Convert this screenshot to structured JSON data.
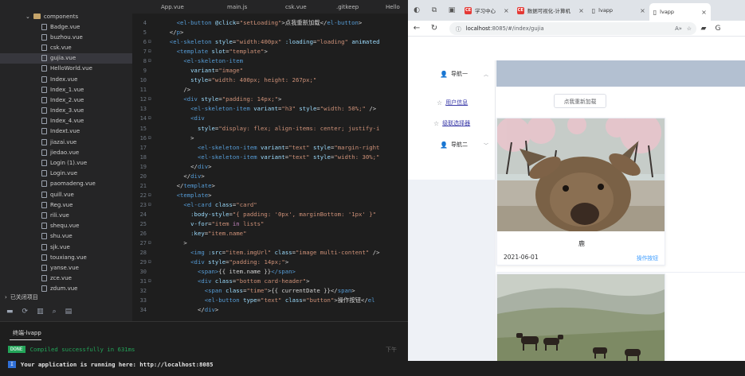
{
  "explorer": {
    "folder": "components",
    "files": [
      "Badge.vue",
      "buzhou.vue",
      "csk.vue",
      "gujia.vue",
      "HelloWorld.vue",
      "Index.vue",
      "Index_1.vue",
      "Index_2.vue",
      "Index_3.vue",
      "Index_4.vue",
      "Indext.vue",
      "jiazai.vue",
      "jiedao.vue",
      "Login (1).vue",
      "Login.vue",
      "paomadeng.vue",
      "quill.vue",
      "Reg.vue",
      "rili.vue",
      "shequ.vue",
      "shu.vue",
      "sjk.vue",
      "touxiang.vue",
      "yanse.vue",
      "zce.vue",
      "zdum.vue"
    ],
    "active_file": "gujia.vue",
    "closed_projects": "已关闭项目"
  },
  "editor": {
    "tabs": [
      "App.vue",
      "main.js",
      "csk.vue",
      ".gitkeep",
      "Hello"
    ],
    "lines": [
      {
        "n": "4",
        "fold": false,
        "html": "<span class='g'>    </span><span class='tg'>&lt;el-button</span> <span class='at'>@click</span>=<span class='st'>\"setLoading\"</span><span class='tx'>&gt;点我重新加载&lt;/</span><span class='tg'>el-button</span><span class='tx'>&gt;</span>"
      },
      {
        "n": "5",
        "fold": false,
        "html": "  <span class='tx'>&lt;/</span><span class='tg'>p</span><span class='tx'>&gt;</span>"
      },
      {
        "n": "6",
        "fold": true,
        "html": "  <span class='tg'>&lt;el-skeleton</span> <span class='at'>style</span>=<span class='st'>\"width:400px\"</span> <span class='at'>:loading</span>=<span class='st'>\"loading\"</span> <span class='at'>animated</span>"
      },
      {
        "n": "7",
        "fold": true,
        "html": "    <span class='tg'>&lt;template</span> <span class='at'>slot</span>=<span class='st'>\"template\"</span><span class='tx'>&gt;</span>"
      },
      {
        "n": "8",
        "fold": true,
        "html": "      <span class='tg'>&lt;el-skeleton-item</span>"
      },
      {
        "n": "9",
        "fold": false,
        "html": "        <span class='at'>variant</span>=<span class='st'>\"image\"</span>"
      },
      {
        "n": "10",
        "fold": false,
        "html": "        <span class='at'>style</span>=<span class='st'>\"width: 400px; height: 267px;\"</span>"
      },
      {
        "n": "11",
        "fold": false,
        "html": "      <span class='tx'>/&gt;</span>"
      },
      {
        "n": "12",
        "fold": true,
        "html": "      <span class='tg'>&lt;div</span> <span class='at'>style</span>=<span class='st'>\"padding: 14px;\"</span><span class='tx'>&gt;</span>"
      },
      {
        "n": "13",
        "fold": false,
        "html": "        <span class='tg'>&lt;el-skeleton-item</span> <span class='at'>variant</span>=<span class='st'>\"h3\"</span> <span class='at'>style</span>=<span class='st'>\"width: 50%;\"</span> <span class='tx'>/&gt;</span>"
      },
      {
        "n": "14",
        "fold": true,
        "html": "        <span class='tg'>&lt;div</span>"
      },
      {
        "n": "15",
        "fold": false,
        "html": "          <span class='at'>style</span>=<span class='st'>\"display: flex; align-items: center; justify-i</span>"
      },
      {
        "n": "16",
        "fold": true,
        "html": "        <span class='tx'>&gt;</span>"
      },
      {
        "n": "17",
        "fold": false,
        "html": "          <span class='tg'>&lt;el-skeleton-item</span> <span class='at'>variant</span>=<span class='st'>\"text\"</span> <span class='at'>style</span>=<span class='st'>\"margin-right</span>"
      },
      {
        "n": "18",
        "fold": false,
        "html": "          <span class='tg'>&lt;el-skeleton-item</span> <span class='at'>variant</span>=<span class='st'>\"text\"</span> <span class='at'>style</span>=<span class='st'>\"width: 30%;\"</span>"
      },
      {
        "n": "19",
        "fold": false,
        "html": "        <span class='tx'>&lt;/</span><span class='tg'>div</span><span class='tx'>&gt;</span>"
      },
      {
        "n": "20",
        "fold": false,
        "html": "      <span class='tx'>&lt;/</span><span class='tg'>div</span><span class='tx'>&gt;</span>"
      },
      {
        "n": "21",
        "fold": false,
        "html": "    <span class='tx'>&lt;/</span><span class='tg'>template</span><span class='tx'>&gt;</span>"
      },
      {
        "n": "22",
        "fold": true,
        "html": "    <span class='tg'>&lt;template</span><span class='tx'>&gt;</span>"
      },
      {
        "n": "23",
        "fold": true,
        "html": "      <span class='tg'>&lt;el-card</span> <span class='at'>class</span>=<span class='st'>\"card\"</span>"
      },
      {
        "n": "24",
        "fold": false,
        "html": "        <span class='at'>:body-style</span>=<span class='st'>\"{ padding: '0px', marginBottom: '1px' }\"</span>"
      },
      {
        "n": "25",
        "fold": false,
        "html": "        <span class='at'>v-for</span>=<span class='st'>\"item <span class='ex'>in</span> lists\"</span>"
      },
      {
        "n": "26",
        "fold": false,
        "html": "        <span class='at'>:key</span>=<span class='st'>\"item.name\"</span>"
      },
      {
        "n": "27",
        "fold": true,
        "html": "      <span class='tx'>&gt;</span>"
      },
      {
        "n": "28",
        "fold": false,
        "html": "        <span class='tg'>&lt;img</span> <span class='at'>:src</span>=<span class='st'>\"item.imgUrl\"</span> <span class='at'>class</span>=<span class='st'>\"image multi-content\"</span> <span class='tx'>/&gt;</span>"
      },
      {
        "n": "29",
        "fold": true,
        "html": "        <span class='tg'>&lt;div</span> <span class='at'>style</span>=<span class='st'>\"padding: 14px;\"</span><span class='tx'>&gt;</span>"
      },
      {
        "n": "30",
        "fold": false,
        "html": "          <span class='tg'>&lt;span&gt;</span><span class='tx'>{{ item.name }}</span><span class='tg'>&lt;/span&gt;</span>"
      },
      {
        "n": "31",
        "fold": true,
        "html": "          <span class='tg'>&lt;div</span> <span class='at'>class</span>=<span class='st'>\"bottom card-header\"</span><span class='tx'>&gt;</span>"
      },
      {
        "n": "32",
        "fold": false,
        "html": "            <span class='tg'>&lt;span</span> <span class='at'>class</span>=<span class='st'>\"time\"</span><span class='tx'>&gt;{{ currentDate }}&lt;/</span><span class='tg'>span</span><span class='tx'>&gt;</span>"
      },
      {
        "n": "33",
        "fold": false,
        "html": "            <span class='tg'>&lt;el-button</span> <span class='at'>type</span>=<span class='st'>\"text\"</span> <span class='at'>class</span>=<span class='st'>\"button\"</span><span class='tx'>&gt;操作按钮&lt;/</span><span class='tg'>el</span>"
      },
      {
        "n": "34",
        "fold": false,
        "html": "          <span class='tx'>&lt;/</span><span class='tg'>div</span><span class='tx'>&gt;</span>"
      }
    ]
  },
  "terminal": {
    "title": "终端-lvapp",
    "done_badge": "DONE",
    "compiled": "Compiled successfully in 631ms",
    "info_badge": "I",
    "running": "Your application is running here: http://localhost:8085",
    "time_hint": "下午"
  },
  "browser": {
    "tabs": [
      {
        "label": "学习中心",
        "logo": "CE",
        "logo_color": "#e53935"
      },
      {
        "label": "数据可视化-计算机",
        "logo": "CE",
        "logo_color": "#e53935"
      },
      {
        "label": "lvapp",
        "logo": "",
        "logo_color": "#ffffff"
      },
      {
        "label": "lvapp",
        "logo": "",
        "logo_color": "#ffffff"
      }
    ],
    "url_host": "localhost",
    "url_path": ":8085/#/index/gujia",
    "page": {
      "menu": [
        {
          "label": "导航一",
          "icon": "user-icon"
        },
        {
          "label": "用户信息",
          "icon": "star-icon"
        },
        {
          "label": "级联选择器",
          "icon": "star-icon"
        },
        {
          "label": "导航二",
          "icon": "user-icon"
        }
      ],
      "reload_button": "点我重新加载",
      "card": {
        "name": "鹿",
        "date": "2021-06-01",
        "action": "操作按钮"
      }
    }
  },
  "colors": {
    "editor_bg": "#1e1e1e",
    "sidebar_bg": "#252526",
    "header_bar": "#b3c0d1",
    "primary": "#409eff",
    "success": "#23a559"
  }
}
